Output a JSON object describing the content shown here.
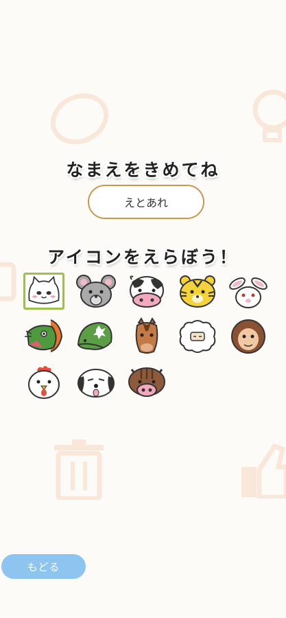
{
  "name_section": {
    "title": "なまえをきめてね",
    "input_value": "えとあれ"
  },
  "icon_section": {
    "title": "アイコンをえらぼう！",
    "selected": "cat",
    "icons": [
      "cat",
      "mouse",
      "cow",
      "tiger",
      "rabbit",
      "dragon",
      "snake",
      "horse",
      "sheep",
      "monkey",
      "rooster",
      "dog",
      "boar"
    ]
  },
  "back_button": {
    "label": "もどる"
  },
  "colors": {
    "accent_border": "#c8974a",
    "selected_border": "#9cc14b",
    "button": "#8ec4f0",
    "background": "#fdfbf8"
  }
}
